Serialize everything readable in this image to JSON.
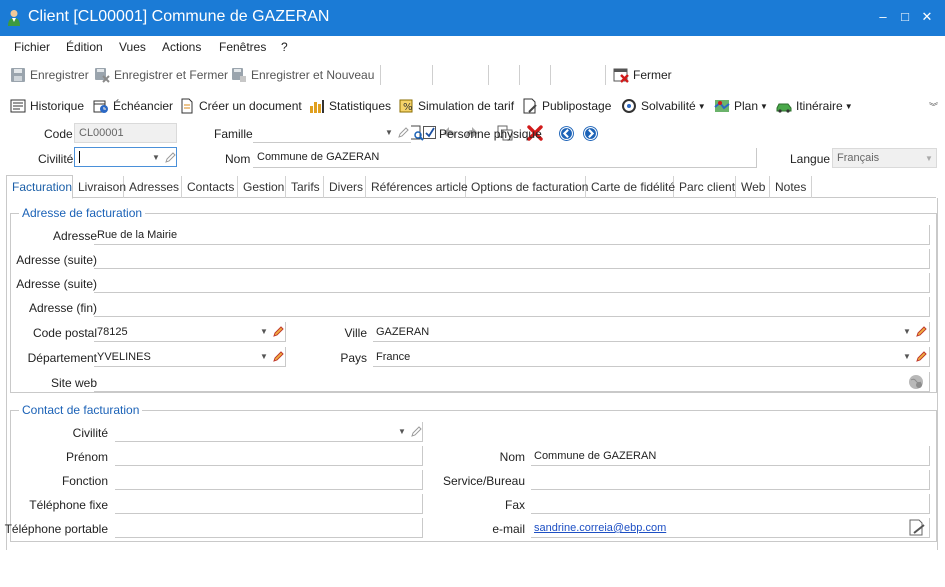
{
  "window": {
    "title": "Client [CL00001] Commune de GAZERAN",
    "controls": [
      "–",
      "□",
      "✕"
    ]
  },
  "menu": [
    "Fichier",
    "Édition",
    "Vues",
    "Actions",
    "Fenêtres",
    "?"
  ],
  "toolbar1": {
    "save": "Enregistrer",
    "save_close": "Enregistrer et Fermer",
    "save_new": "Enregistrer et Nouveau",
    "close": "Fermer"
  },
  "toolbar2": {
    "history": "Historique",
    "schedule": "Échéancier",
    "create_doc": "Créer un document",
    "stats": "Statistiques",
    "rate_sim": "Simulation de tarif",
    "mailing": "Publipostage",
    "solvency": "Solvabilité",
    "map": "Plan",
    "route": "Itinéraire"
  },
  "header": {
    "code_label": "Code",
    "code_value": "CL00001",
    "family_label": "Famille",
    "family_value": "",
    "person_label": "Personne physique",
    "person_checked": true,
    "civility_label": "Civilité",
    "civility_value": "",
    "name_label": "Nom",
    "name_value": "Commune de GAZERAN",
    "language_label": "Langue",
    "language_value": "Français"
  },
  "tabs": [
    "Facturation",
    "Livraison",
    "Adresses",
    "Contacts",
    "Gestion",
    "Tarifs",
    "Divers",
    "Références article",
    "Options de facturation",
    "Carte de fidélité",
    "Parc client",
    "Web",
    "Notes"
  ],
  "billing_address": {
    "title": "Adresse de facturation",
    "address_label": "Adresse",
    "address_value": "Rue de la Mairie",
    "address2_label": "Adresse (suite)",
    "address2_value": "",
    "address3_label": "Adresse (suite)",
    "address3_value": "",
    "address4_label": "Adresse (fin)",
    "address4_value": "",
    "zip_label": "Code postal",
    "zip_value": "78125",
    "city_label": "Ville",
    "city_value": "GAZERAN",
    "dept_label": "Département",
    "dept_value": "YVELINES",
    "country_label": "Pays",
    "country_value": "France",
    "website_label": "Site web",
    "website_value": ""
  },
  "billing_contact": {
    "title": "Contact de facturation",
    "civility_label": "Civilité",
    "civility_value": "",
    "firstname_label": "Prénom",
    "firstname_value": "",
    "name_label": "Nom",
    "name_value": "Commune de GAZERAN",
    "function_label": "Fonction",
    "function_value": "",
    "service_label": "Service/Bureau",
    "service_value": "",
    "phone_label": "Téléphone fixe",
    "phone_value": "",
    "fax_label": "Fax",
    "fax_value": "",
    "mobile_label": "Téléphone portable",
    "mobile_value": "",
    "email_label": "e-mail",
    "email_value": "sandrine.correia@ebp.com"
  },
  "colors": {
    "titlebar": "#1b7bd6",
    "group_title": "#1b62b7",
    "link": "#1d4fc4",
    "delete": "#d11a1a"
  }
}
